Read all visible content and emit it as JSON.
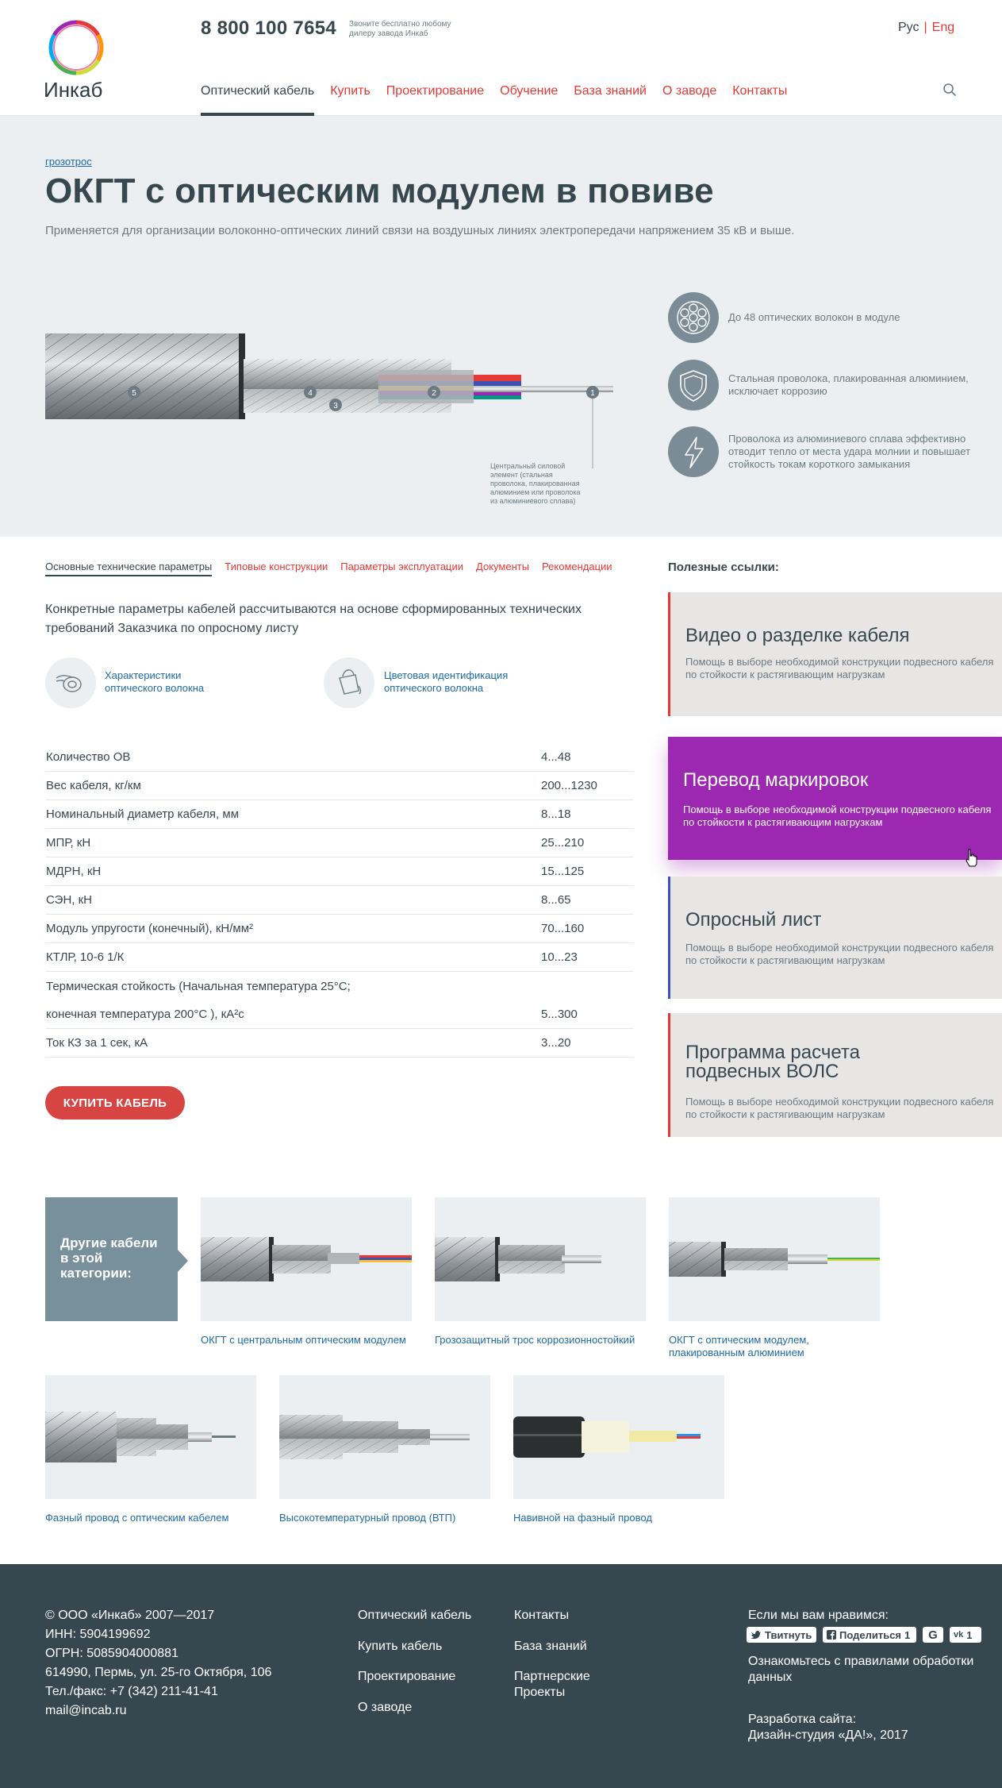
{
  "header": {
    "logo_text": "Инкаб",
    "phone": "8 800 100 7654",
    "phone_note": "Звоните бесплатно любому дилеру завода Инкаб",
    "lang_ru": "Рус",
    "lang_sep": "|",
    "lang_en": "Eng",
    "nav": [
      "Оптический кабель",
      "Купить",
      "Проектирование",
      "Обучение",
      "База знаний",
      "О заводе",
      "Контакты"
    ]
  },
  "hero": {
    "breadcrumb": "грозотрос",
    "title": "ОКГТ с оптическим модулем в повиве",
    "lead": "Применяется для организации волоконно-оптических линий связи на воздушных линиях электропередачи напряжением 35 кВ и выше.",
    "cable_note": "Центральный силовой элемент (стальная проволока, плакированная алюминием или проволока из алюминиевого сплава)",
    "markers": [
      "5",
      "4",
      "3",
      "2",
      "1"
    ],
    "features": [
      {
        "icon": "fiber-bundle-icon",
        "text": "До 48 оптических волокон в модуле"
      },
      {
        "icon": "shield-icon",
        "text": "Стальная проволока, плакированная алюминием, исключает коррозию"
      },
      {
        "icon": "lightning-icon",
        "text": "Проволока из алюминиевого сплава эффективно отводит тепло от места удара молнии и повышает стойкость токам короткого замыкания"
      }
    ]
  },
  "tabs": [
    "Основные технические параметры",
    "Типовые конструкции",
    "Параметры эксплуатации",
    "Документы",
    "Рекомендации"
  ],
  "intro": "Конкретные параметры кабелей рассчитываются на основе сформированных технических требований Заказчика по опросному листу",
  "quick_links": [
    {
      "icon": "fiber-spool-icon",
      "label": "Характеристики оптического волокна"
    },
    {
      "icon": "paint-bucket-icon",
      "label": "Цветовая идентификация оптического волокна"
    }
  ],
  "params": [
    {
      "k": "Количество ОВ",
      "v": "4...48"
    },
    {
      "k": "Вес кабеля, кг/км",
      "v": "200...1230"
    },
    {
      "k": "Номинальный диаметр кабеля, мм",
      "v": "8...18"
    },
    {
      "k": "МПР, кН",
      "v": "25...210"
    },
    {
      "k": "МДРН, кН",
      "v": "15...125"
    },
    {
      "k": "СЭН, кН",
      "v": "8...65"
    },
    {
      "k": "Модуль упругости (конечный), кН/мм²",
      "v": "70...160"
    },
    {
      "k": "КТЛР, 10-6 1/К",
      "v": "10...23"
    },
    {
      "k": "Термическая стойкость (Начальная температура 25°С;",
      "v": ""
    },
    {
      "k": "конечная температура 200°С ), кА²с",
      "v": "5...300"
    },
    {
      "k": "Ток КЗ за 1 сек, кА",
      "v": "3...20"
    }
  ],
  "buy_button": "КУПИТЬ КАБЕЛЬ",
  "useful": {
    "title": "Полезные ссылки:",
    "cards": [
      {
        "title": "Видео о разделке кабеля",
        "desc": "Помощь в выборе необходимой конструкции подвесного кабеля по стойкости к растягивающим нагрузкам",
        "accent": "#e53935"
      },
      {
        "title": "Перевод маркировок",
        "desc": "Помощь в выборе необходимой конструкции подвесного кабеля по стойкости к растягивающим нагрузкам",
        "accent": "#9c27b0"
      },
      {
        "title": "Опросный лист",
        "desc": "Помощь в выборе необходимой конструкции подвесного кабеля по стойкости к растягивающим нагрузкам",
        "accent": "#3f51b5"
      },
      {
        "title": "Программа расчета подвесных ВОЛС",
        "desc": "Помощь в выборе необходимой конструкции подвесного кабеля по стойкости к растягивающим нагрузкам",
        "accent": "#e53935"
      }
    ]
  },
  "other": {
    "title": "Другие кабели в этой категории:",
    "items": [
      "ОКГТ с центральным оптическим модулем",
      "Грозозащитный трос коррозионностойкий",
      "ОКГТ с оптическим модулем, плакированным алюминием",
      "Фазный провод с оптическим кабелем",
      "Высокотемпературный провод (ВТП)",
      "Навивной на фазный провод"
    ]
  },
  "footer": {
    "company": [
      "© ООО «Инкаб» 2007—2017",
      "ИНН: 5904199692",
      "ОГРН: 5085904000881",
      "614990, Пермь, ул. 25-го Октября, 106",
      "Тел./факс: +7 (342) 211-41-41",
      "mail@incab.ru"
    ],
    "links_col1": [
      "Оптический кабель",
      "Купить кабель",
      "Проектирование",
      "О заводе"
    ],
    "links_col2": [
      "Контакты",
      "База знаний",
      "Партнерские Проекты"
    ],
    "like_text": "Если мы вам нравимся:",
    "share": {
      "twitter": "Твитнуть",
      "facebook": "Поделиться",
      "facebook_count": "1",
      "vk_count": "1"
    },
    "policy": "Ознакомьтесь с правилами обработки данных",
    "dev_label": "Разработка сайта:",
    "dev_name": "Дизайн-студия «ДА!», 2017"
  },
  "colors": {
    "accent_red": "#e53935",
    "dark": "#37474f",
    "purple": "#9c27b0",
    "link_blue": "#1e6ba8"
  }
}
